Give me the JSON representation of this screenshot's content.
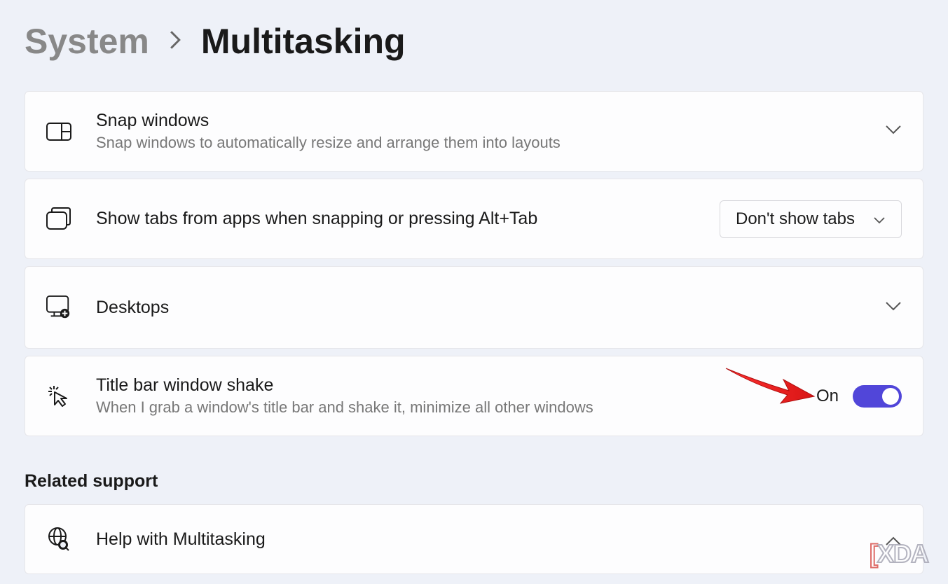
{
  "breadcrumb": {
    "parent": "System",
    "current": "Multitasking"
  },
  "cards": {
    "snap_windows": {
      "title": "Snap windows",
      "description": "Snap windows to automatically resize and arrange them into layouts"
    },
    "show_tabs": {
      "title": "Show tabs from apps when snapping or pressing Alt+Tab",
      "dropdown_value": "Don't show tabs"
    },
    "desktops": {
      "title": "Desktops"
    },
    "title_bar_shake": {
      "title": "Title bar window shake",
      "description": "When I grab a window's title bar and shake it, minimize all other windows",
      "toggle_state": "On"
    }
  },
  "related_support": {
    "heading": "Related support",
    "help_item": "Help with Multitasking"
  },
  "watermark": "XDA"
}
